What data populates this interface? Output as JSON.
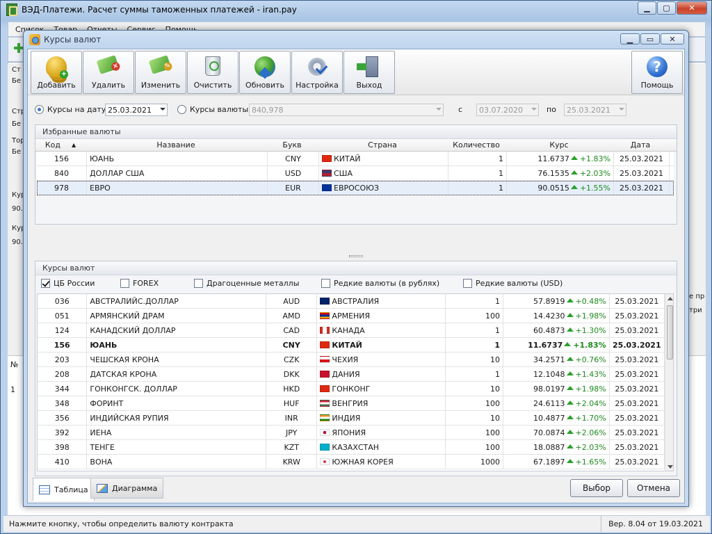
{
  "main_window": {
    "title": "ВЭД-Платежи. Расчет суммы таможенных платежей - iran.pay",
    "menu": [
      "Список",
      "Товар",
      "Отчеты",
      "Сервис",
      "Помощь"
    ],
    "left_labels": [
      "Ст",
      "Бе",
      "Стр",
      "Бе",
      "Тор",
      "Бе",
      "Курс",
      "90.",
      "Курс",
      "90."
    ],
    "right_labels": [
      "е пр",
      "три"
    ],
    "grid_header": "№",
    "grid_row": "1",
    "status": {
      "hint": "Нажмите кнопку, чтобы определить валюту контракта",
      "version": "Вер. 8.04 от 19.03.2021"
    }
  },
  "dialog": {
    "title": "Курсы валют",
    "toolbar": {
      "add": "Добавить",
      "delete": "Удалить",
      "edit": "Изменить",
      "clear": "Очистить",
      "refresh": "Обновить",
      "settings": "Настройка",
      "exit": "Выход",
      "help": "Помощь"
    },
    "filter": {
      "by_date_label": "Курсы на дату",
      "by_date_value": "25.03.2021",
      "by_currency_label": "Курсы валюты",
      "by_currency_value": "840,978",
      "from_label": "с",
      "from_value": "03.07.2020",
      "to_label": "по",
      "to_value": "25.03.2021"
    },
    "favorites": {
      "title": "Избранные валюты",
      "columns": [
        "Код",
        "Название",
        "Букв",
        "Страна",
        "Количество",
        "Курс",
        "Дата"
      ],
      "rows": [
        {
          "code": "156",
          "name": "ЮАНЬ",
          "letters": "CNY",
          "country": "КИТАЙ",
          "qty": "1",
          "rate": "11.6737",
          "change": "+1.83%",
          "date": "25.03.2021"
        },
        {
          "code": "840",
          "name": "ДОЛЛАР США",
          "letters": "USD",
          "country": "США",
          "qty": "1",
          "rate": "76.1535",
          "change": "+2.03%",
          "date": "25.03.2021"
        },
        {
          "code": "978",
          "name": "ЕВРО",
          "letters": "EUR",
          "country": "ЕВРОСОЮЗ",
          "qty": "1",
          "rate": "90.0515",
          "change": "+1.55%",
          "date": "25.03.2021"
        }
      ]
    },
    "rates": {
      "title": "Курсы валют",
      "checkboxes": [
        {
          "label": "ЦБ России",
          "checked": true
        },
        {
          "label": "FOREX",
          "checked": false
        },
        {
          "label": "Драгоценные металлы",
          "checked": false
        },
        {
          "label": "Редкие валюты (в рублях)",
          "checked": false
        },
        {
          "label": "Редкие валюты (USD)",
          "checked": false
        }
      ],
      "rows": [
        {
          "code": "036",
          "name": "АВСТРАЛИЙС.ДОЛЛАР",
          "letters": "AUD",
          "country": "АВСТРАЛИЯ",
          "qty": "1",
          "rate": "57.8919",
          "change": "+0.48%",
          "date": "25.03.2021"
        },
        {
          "code": "051",
          "name": "АРМЯНСКИЙ ДРАМ",
          "letters": "AMD",
          "country": "АРМЕНИЯ",
          "qty": "100",
          "rate": "14.4230",
          "change": "+1.98%",
          "date": "25.03.2021"
        },
        {
          "code": "124",
          "name": "КАНАДСКИЙ ДОЛЛАР",
          "letters": "CAD",
          "country": "КАНАДА",
          "qty": "1",
          "rate": "60.4873",
          "change": "+1.30%",
          "date": "25.03.2021"
        },
        {
          "code": "156",
          "name": "ЮАНЬ",
          "letters": "CNY",
          "country": "КИТАЙ",
          "qty": "1",
          "rate": "11.6737",
          "change": "+1.83%",
          "date": "25.03.2021"
        },
        {
          "code": "203",
          "name": "ЧЕШСКАЯ КРОНА",
          "letters": "CZK",
          "country": "ЧЕХИЯ",
          "qty": "10",
          "rate": "34.2571",
          "change": "+0.76%",
          "date": "25.03.2021"
        },
        {
          "code": "208",
          "name": "ДАТСКАЯ КРОНА",
          "letters": "DKK",
          "country": "ДАНИЯ",
          "qty": "1",
          "rate": "12.1048",
          "change": "+1.43%",
          "date": "25.03.2021"
        },
        {
          "code": "344",
          "name": "ГОНКОНГСК. ДОЛЛАР",
          "letters": "HKD",
          "country": "ГОНКОНГ",
          "qty": "10",
          "rate": "98.0197",
          "change": "+1.98%",
          "date": "25.03.2021"
        },
        {
          "code": "348",
          "name": "ФОРИНТ",
          "letters": "HUF",
          "country": "ВЕНГРИЯ",
          "qty": "100",
          "rate": "24.6113",
          "change": "+2.04%",
          "date": "25.03.2021"
        },
        {
          "code": "356",
          "name": "ИНДИЙСКАЯ РУПИЯ",
          "letters": "INR",
          "country": "ИНДИЯ",
          "qty": "10",
          "rate": "10.4877",
          "change": "+1.70%",
          "date": "25.03.2021"
        },
        {
          "code": "392",
          "name": "ИЕНА",
          "letters": "JPY",
          "country": "ЯПОНИЯ",
          "qty": "100",
          "rate": "70.0874",
          "change": "+2.06%",
          "date": "25.03.2021"
        },
        {
          "code": "398",
          "name": "ТЕНГЕ",
          "letters": "KZT",
          "country": "КАЗАХСТАН",
          "qty": "100",
          "rate": "18.0887",
          "change": "+2.03%",
          "date": "25.03.2021"
        },
        {
          "code": "410",
          "name": "ВОНА",
          "letters": "KRW",
          "country": "ЮЖНАЯ КОРЕЯ",
          "qty": "1000",
          "rate": "67.1897",
          "change": "+1.65%",
          "date": "25.03.2021"
        }
      ]
    },
    "tabs": {
      "table": "Таблица",
      "chart": "Диаграмма"
    },
    "buttons": {
      "select": "Выбор",
      "cancel": "Отмена"
    }
  }
}
